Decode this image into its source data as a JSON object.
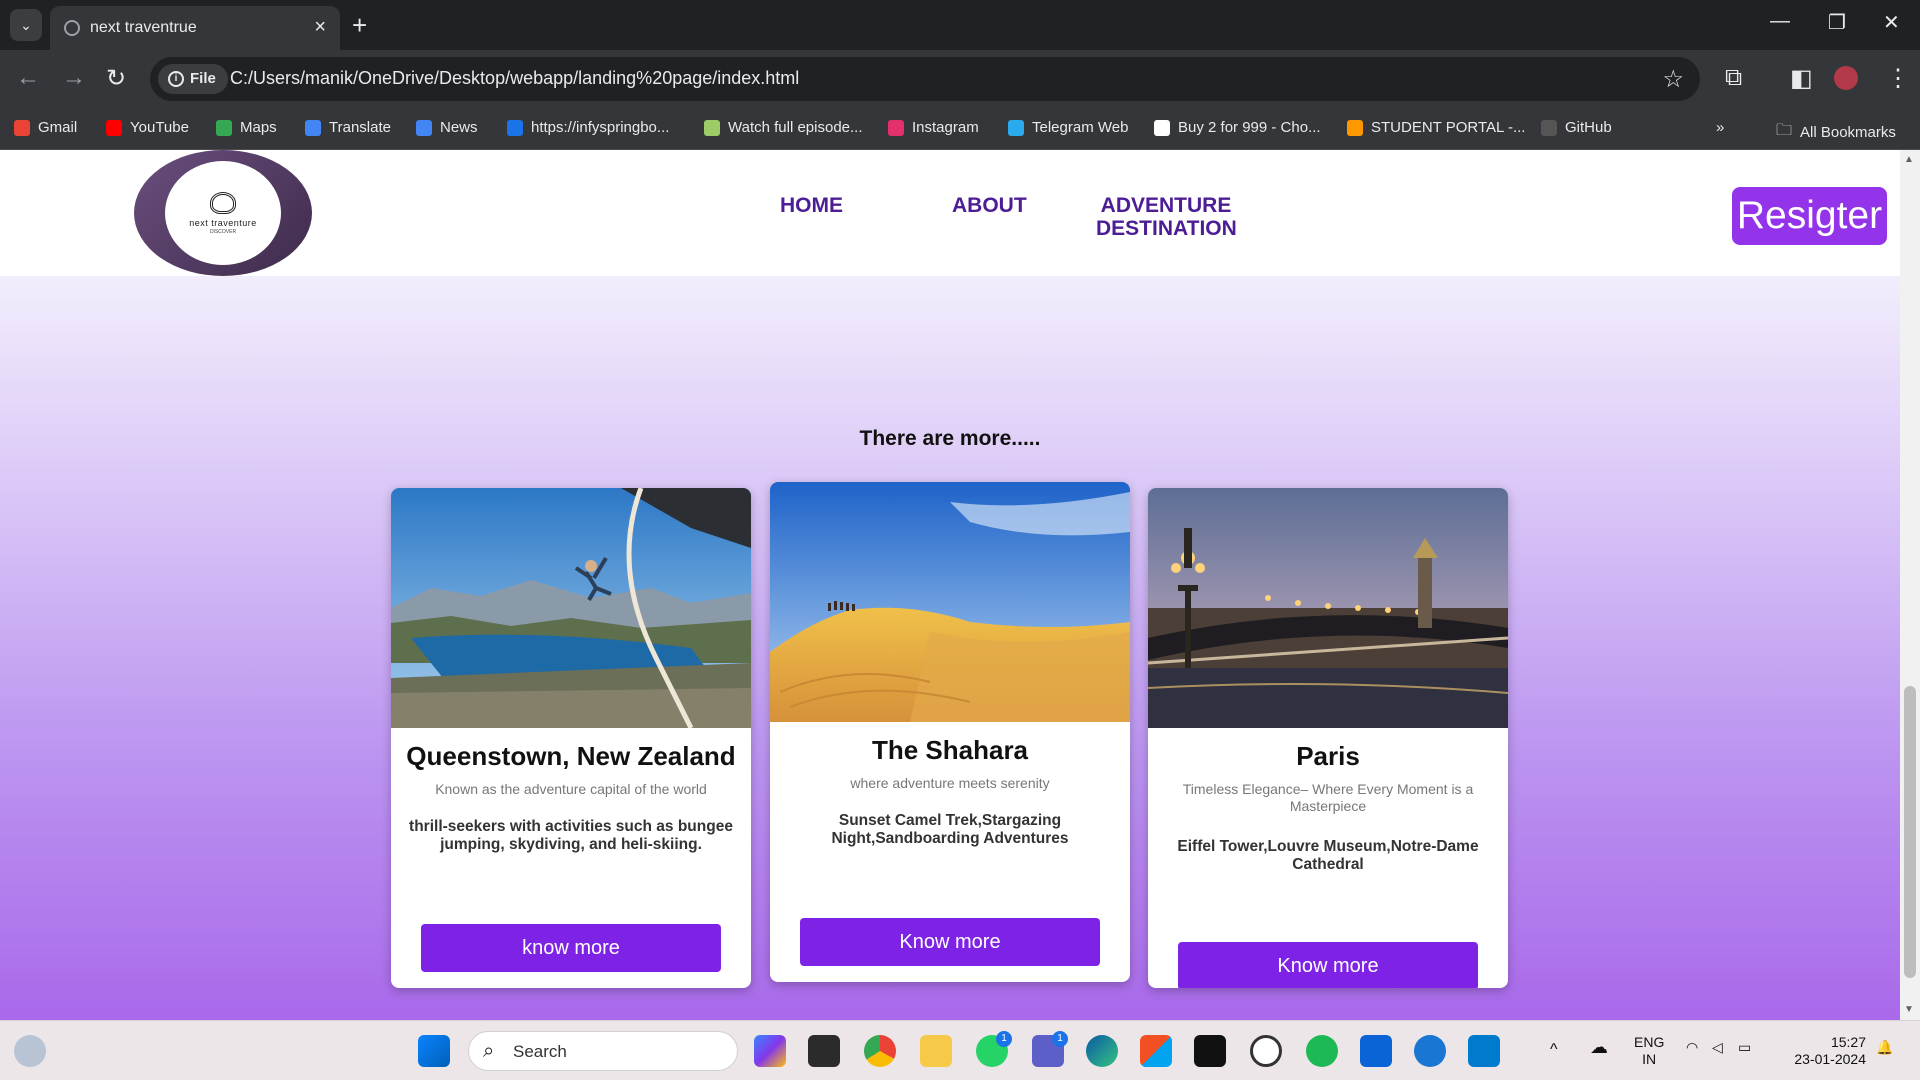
{
  "browser": {
    "tab_title": "next traventrue",
    "new_tab_symbol": "+",
    "chip_label": "File",
    "url": "C:/Users/manik/OneDrive/Desktop/webapp/landing%20page/index.html",
    "bookmarks": [
      {
        "label": "Gmail",
        "color": "#ea4335"
      },
      {
        "label": "YouTube",
        "color": "#ff0000"
      },
      {
        "label": "Maps",
        "color": "#34a853"
      },
      {
        "label": "Translate",
        "color": "#4285f4"
      },
      {
        "label": "News",
        "color": "#4285f4"
      },
      {
        "label": "https://infyspringbo...",
        "color": "#1a73e8"
      },
      {
        "label": "Watch full episode...",
        "color": "#9ccc65"
      },
      {
        "label": "Instagram",
        "color": "#e1306c"
      },
      {
        "label": "Telegram Web",
        "color": "#2aabee"
      },
      {
        "label": "Buy 2 for 999 - Cho...",
        "color": "#ffffff"
      },
      {
        "label": "STUDENT PORTAL -...",
        "color": "#ff9800"
      },
      {
        "label": "GitHub",
        "color": "#555555"
      }
    ],
    "all_bookmarks": "All Bookmarks"
  },
  "site": {
    "logo_text": "next traventure",
    "logo_sub": "DISCOVER",
    "nav": {
      "home": "HOME",
      "about": "ABOUT",
      "adventure_line1": "ADVENTURE",
      "adventure_line2": "DESTINATION"
    },
    "register_label": "Resigter",
    "section_title": "There are more.....",
    "cards": [
      {
        "title": "Queenstown, New Zealand",
        "subtitle": "Known as the adventure capital of the world",
        "description": "thrill-seekers with activities such as bungee jumping, skydiving, and heli-skiing.",
        "button": "know more"
      },
      {
        "title": "The Shahara",
        "subtitle": "where adventure meets serenity",
        "description": "Sunset Camel Trek,Stargazing Night,Sandboarding Adventures",
        "button": "Know more"
      },
      {
        "title": "Paris",
        "subtitle": "Timeless Elegance– Where Every Moment is a Masterpiece",
        "description": "Eiffel Tower,Louvre Museum,Notre-Dame Cathedral",
        "button": "Know more"
      }
    ]
  },
  "taskbar": {
    "search_label": "Search",
    "lang_line1": "ENG",
    "lang_line2": "IN",
    "time": "15:27",
    "date": "23-01-2024",
    "whatsapp_badge": "1",
    "teams_badge": "1"
  },
  "colors": {
    "accent": "#7e22e6",
    "register": "#9333ea",
    "nav_text": "#4c1d95"
  }
}
